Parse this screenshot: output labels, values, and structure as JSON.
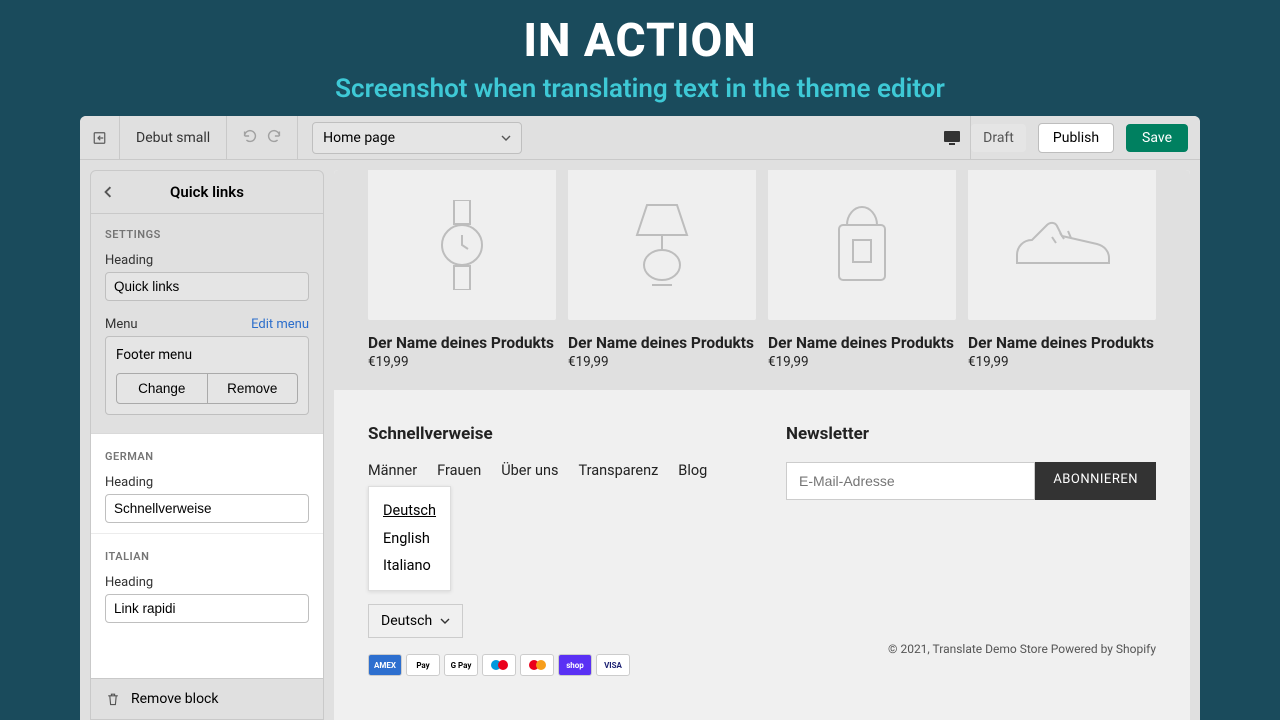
{
  "hero": {
    "title": "IN ACTION",
    "subtitle": "Screenshot when translating text in the theme editor"
  },
  "toolbar": {
    "theme_name": "Debut small",
    "page_select": "Home page",
    "draft": "Draft",
    "publish": "Publish",
    "save": "Save"
  },
  "sidebar": {
    "title": "Quick links",
    "settings_label": "SETTINGS",
    "heading_label": "Heading",
    "heading_value": "Quick links",
    "menu_label": "Menu",
    "edit_menu": "Edit menu",
    "menu_name": "Footer menu",
    "change": "Change",
    "remove": "Remove",
    "remove_block": "Remove block",
    "translations": [
      {
        "lang_label": "GERMAN",
        "heading_label": "Heading",
        "value": "Schnellverweise"
      },
      {
        "lang_label": "ITALIAN",
        "heading_label": "Heading",
        "value": "Link rapidi"
      }
    ]
  },
  "preview": {
    "products": [
      {
        "name": "Der Name deines Produkts",
        "price": "€19,99",
        "icon": "watch"
      },
      {
        "name": "Der Name deines Produkts",
        "price": "€19,99",
        "icon": "lamp"
      },
      {
        "name": "Der Name deines Produkts",
        "price": "€19,99",
        "icon": "bag"
      },
      {
        "name": "Der Name deines Produkts",
        "price": "€19,99",
        "icon": "shoe"
      }
    ],
    "footer": {
      "quicklinks_title": "Schnellverweise",
      "links": [
        "Männer",
        "Frauen",
        "Über uns",
        "Transparenz",
        "Blog"
      ],
      "newsletter_title": "Newsletter",
      "email_placeholder": "E-Mail-Adresse",
      "subscribe": "ABONNIEREN",
      "lang_popup": [
        "Deutsch",
        "English",
        "Italiano"
      ],
      "lang_selected": "Deutsch",
      "copyright": "© 2021, Translate Demo Store Powered by Shopify",
      "cards": [
        "AMEX",
        "Pay",
        "G Pay",
        "maestro",
        "mc",
        "shop",
        "VISA"
      ]
    }
  }
}
